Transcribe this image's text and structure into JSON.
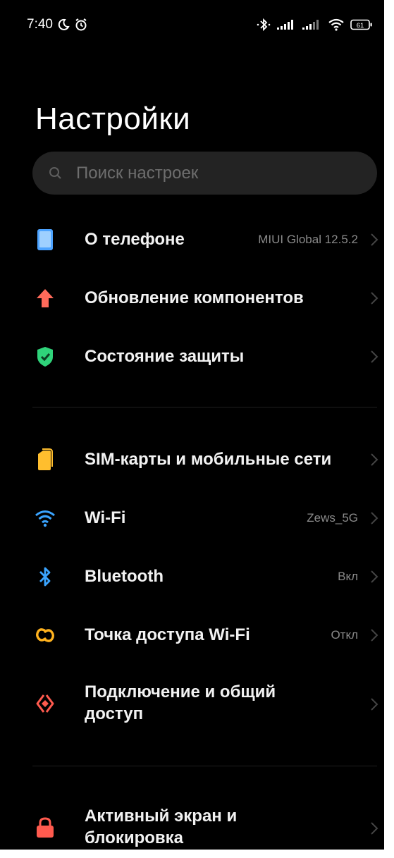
{
  "status_bar": {
    "time": "7:40",
    "battery": "61",
    "icons": [
      "moon-icon",
      "alarm-icon",
      "bluetooth-icon",
      "signal-icon",
      "signal-icon",
      "wifi-icon",
      "battery-icon"
    ]
  },
  "page": {
    "title": "Настройки"
  },
  "search": {
    "placeholder": "Поиск настроек"
  },
  "sections": [
    {
      "items": [
        {
          "label": "О телефоне",
          "value": "MIUI Global 12.5.2",
          "icon": "phone-icon",
          "color": "#4da3ff"
        },
        {
          "label": "Обновление компонентов",
          "value": "",
          "icon": "arrow-up-icon",
          "color": "#ff6a5a"
        },
        {
          "label": "Состояние защиты",
          "value": "",
          "icon": "shield-check-icon",
          "color": "#2fd37a"
        }
      ]
    },
    {
      "items": [
        {
          "label": "SIM-карты и мобильные сети",
          "value": "",
          "icon": "sim-icon",
          "color": "#ffbe2e"
        },
        {
          "label": "Wi-Fi",
          "value": "Zews_5G",
          "icon": "wifi-icon",
          "color": "#3aa4ff"
        },
        {
          "label": "Bluetooth",
          "value": "Вкл",
          "icon": "bluetooth-icon",
          "color": "#3aa4ff"
        },
        {
          "label": "Точка доступа Wi-Fi",
          "value": "Откл",
          "icon": "hotspot-icon",
          "color": "#ffb21e"
        },
        {
          "label": "Подключение и общий доступ",
          "label_line1": "Подключение и общий",
          "label_line2": "доступ",
          "value": "",
          "icon": "connection-share-icon",
          "color": "#ff5a4e"
        }
      ]
    },
    {
      "items": [
        {
          "label": "Активный экран и блокировка",
          "label_line1": "Активный экран и",
          "label_line2": "блокировка",
          "value": "",
          "icon": "lock-icon",
          "color": "#ff5a4e"
        }
      ]
    }
  ]
}
